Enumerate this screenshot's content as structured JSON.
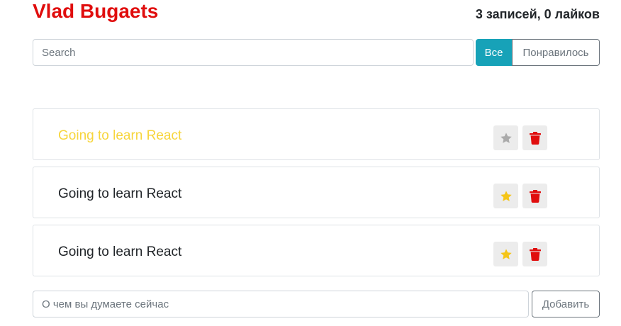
{
  "header": {
    "title": "Vlad Bugaets",
    "stats": "3 записей, 0 лайков"
  },
  "search": {
    "placeholder": "Search",
    "value": ""
  },
  "filters": [
    {
      "label": "Все",
      "active": true
    },
    {
      "label": "Понравилось",
      "active": false
    }
  ],
  "posts": [
    {
      "label": "Going to learn React",
      "important": true,
      "star_color": "#aaaaaa",
      "star_icon": "star-icon",
      "delete_icon": "trash-icon"
    },
    {
      "label": "Going to learn React",
      "important": false,
      "star_color": "#f5c518",
      "star_icon": "star-icon",
      "delete_icon": "trash-icon"
    },
    {
      "label": "Going to learn React",
      "important": false,
      "star_color": "#f5c518",
      "star_icon": "star-icon",
      "delete_icon": "trash-icon"
    }
  ],
  "add_form": {
    "placeholder": "О чем вы думаете сейчас",
    "value": "",
    "button_label": "Добавить"
  },
  "colors": {
    "title": "#e00d0d",
    "accent": "#17a2b8",
    "important_text": "#f7d53c",
    "delete": "#e00d0d"
  }
}
